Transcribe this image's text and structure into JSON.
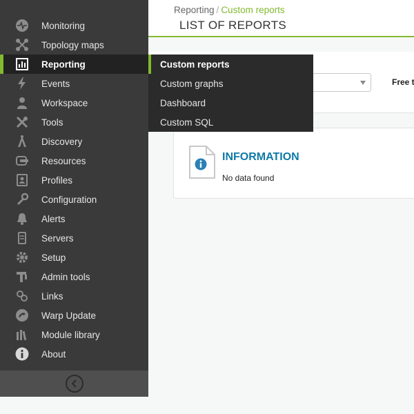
{
  "sidebar": {
    "items": [
      {
        "label": "Monitoring",
        "icon": "monitoring-icon"
      },
      {
        "label": "Topology maps",
        "icon": "topology-icon"
      },
      {
        "label": "Reporting",
        "icon": "reporting-icon",
        "active": true
      },
      {
        "label": "Events",
        "icon": "events-icon"
      },
      {
        "label": "Workspace",
        "icon": "workspace-icon"
      },
      {
        "label": "Tools",
        "icon": "tools-icon"
      },
      {
        "label": "Discovery",
        "icon": "discovery-icon"
      },
      {
        "label": "Resources",
        "icon": "resources-icon"
      },
      {
        "label": "Profiles",
        "icon": "profiles-icon"
      },
      {
        "label": "Configuration",
        "icon": "configuration-icon"
      },
      {
        "label": "Alerts",
        "icon": "alerts-icon"
      },
      {
        "label": "Servers",
        "icon": "servers-icon"
      },
      {
        "label": "Setup",
        "icon": "setup-icon"
      },
      {
        "label": "Admin tools",
        "icon": "admin-tools-icon"
      },
      {
        "label": "Links",
        "icon": "links-icon"
      },
      {
        "label": "Warp Update",
        "icon": "warp-update-icon"
      },
      {
        "label": "Module library",
        "icon": "module-library-icon"
      },
      {
        "label": "About",
        "icon": "about-icon"
      }
    ]
  },
  "submenu": {
    "items": [
      {
        "label": "Custom reports",
        "active": true
      },
      {
        "label": "Custom graphs"
      },
      {
        "label": "Dashboard"
      },
      {
        "label": "Custom SQL"
      }
    ]
  },
  "header": {
    "breadcrumb_parent": "Reporting",
    "breadcrumb_separator": "/",
    "breadcrumb_current": "Custom reports",
    "title": "LIST OF REPORTS"
  },
  "filter": {
    "group_value": "",
    "free_text_label": "Free t"
  },
  "info": {
    "title": "INFORMATION",
    "message": "No data found"
  },
  "colors": {
    "accent": "#82b92e",
    "sidebar_bg": "#3a3a3a",
    "submenu_bg": "#2b2b2b",
    "info_title": "#0e7aa8"
  }
}
